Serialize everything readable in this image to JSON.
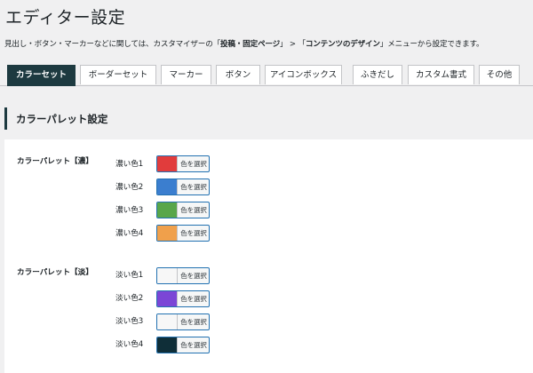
{
  "page_title": "エディター設定",
  "description": {
    "prefix": "見出し・ボタン・マーカーなどに関しては、カスタマイザーの「",
    "link1": "投稿・固定ページ",
    "mid": "」 > 「",
    "link2": "コンテンツのデザイン",
    "suffix": "」メニューから設定できます。"
  },
  "tabs": [
    {
      "label": "カラーセット",
      "active": true
    },
    {
      "label": "ボーダーセット",
      "active": false
    },
    {
      "label": "マーカー",
      "active": false
    },
    {
      "label": "ボタン",
      "active": false
    },
    {
      "label": "アイコンボックス",
      "active": false
    },
    {
      "label": "ふきだし",
      "active": false
    },
    {
      "label": "カスタム書式",
      "active": false
    },
    {
      "label": "その他",
      "active": false
    }
  ],
  "section_title": "カラーパレット設定",
  "picker_button_label": "色を選択",
  "groups": [
    {
      "label": "カラーパレット【濃】",
      "items": [
        {
          "label": "濃い色1",
          "color": "#e13c3c"
        },
        {
          "label": "濃い色2",
          "color": "#3b7ecf"
        },
        {
          "label": "濃い色3",
          "color": "#58a64a"
        },
        {
          "label": "濃い色4",
          "color": "#f0a04b"
        }
      ]
    },
    {
      "label": "カラーパレット【淡】",
      "items": [
        {
          "label": "淡い色1",
          "color": "#f7f7f7"
        },
        {
          "label": "淡い色2",
          "color": "#7b46d6"
        },
        {
          "label": "淡い色3",
          "color": "#f7f7f7"
        },
        {
          "label": "淡い色4",
          "color": "#0f2e38"
        }
      ]
    }
  ]
}
